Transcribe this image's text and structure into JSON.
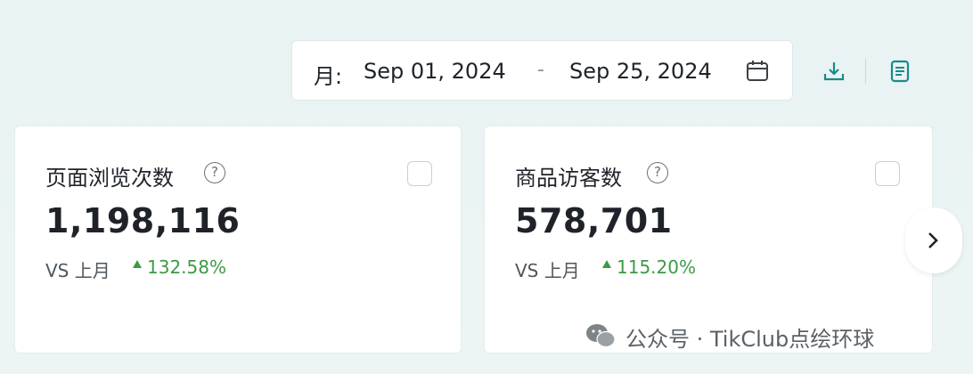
{
  "date_range": {
    "granularity_label": "月:",
    "start_date": "Sep 01, 2024",
    "separator": "-",
    "end_date": "Sep 25, 2024"
  },
  "cards": [
    {
      "title": "页面浏览次数",
      "value": "1,198,116",
      "compare_label": "VS 上月",
      "change": "132.58%",
      "change_direction": "up"
    },
    {
      "title": "商品访客数",
      "value": "578,701",
      "compare_label": "VS 上月",
      "change": "115.20%",
      "change_direction": "up"
    }
  ],
  "watermark": {
    "text": "公众号 · TikClub点绘环球"
  },
  "colors": {
    "accent": "#1a8a8a",
    "positive": "#3c9a45",
    "background": "#eaf3f3"
  },
  "icons": {
    "calendar": "calendar-icon",
    "download": "download-icon",
    "report": "report-icon",
    "next": "chevron-right-icon",
    "help": "question-icon",
    "wechat": "wechat-icon"
  }
}
